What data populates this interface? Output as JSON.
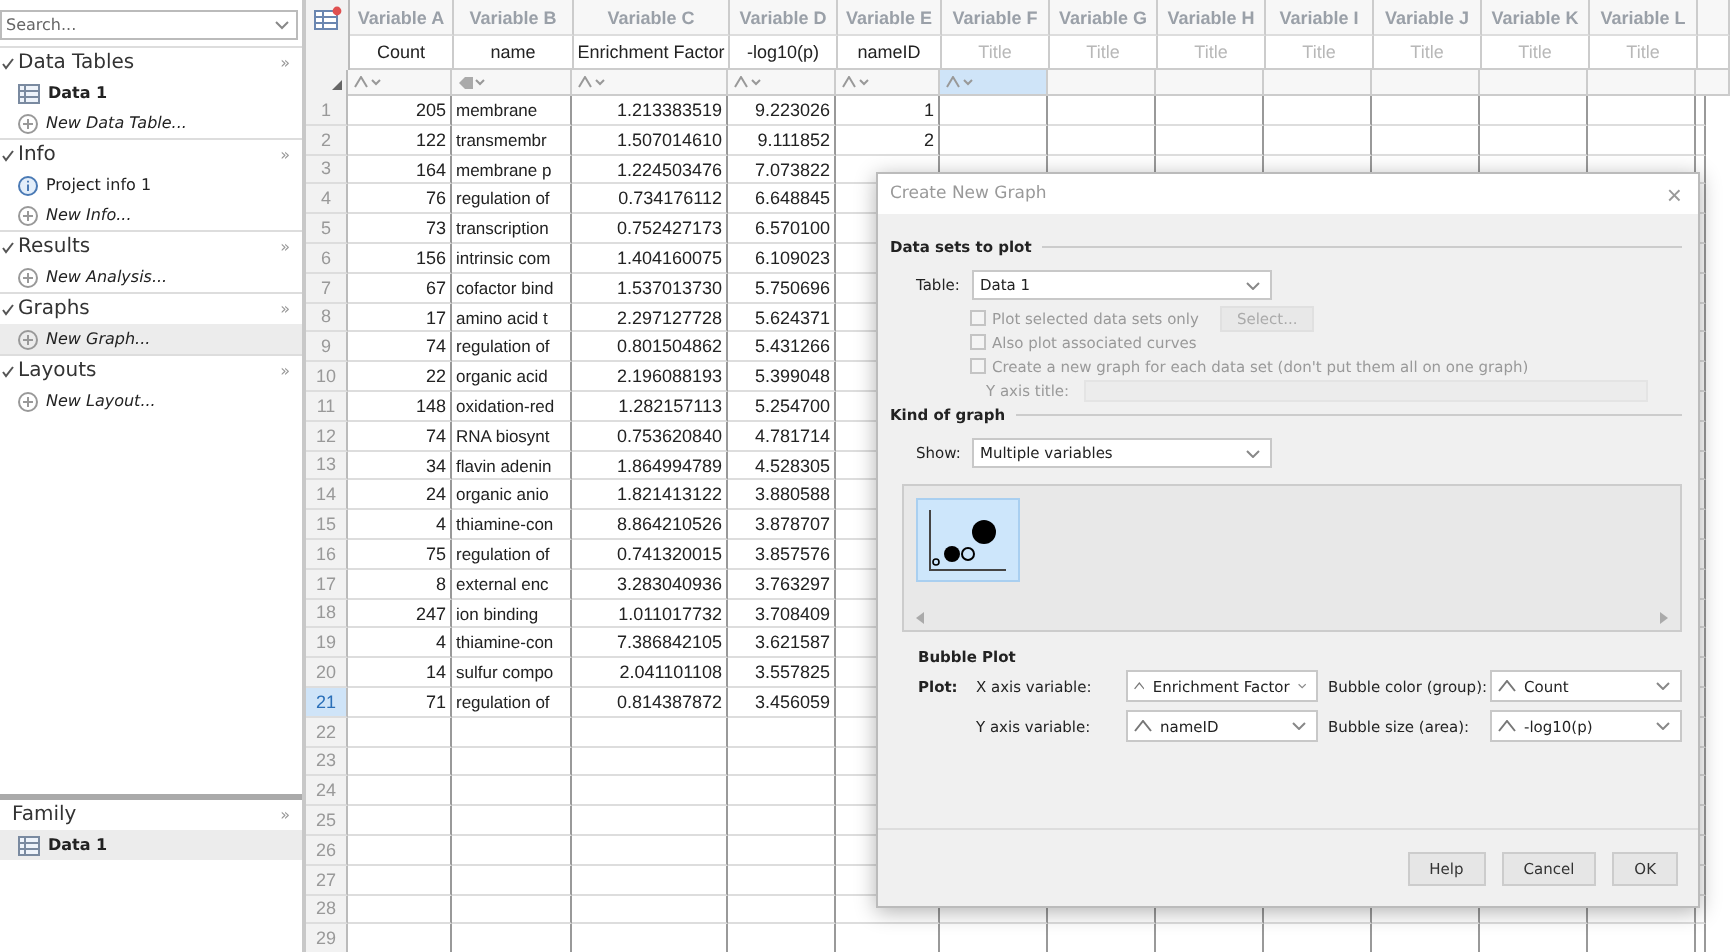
{
  "sidebar": {
    "search": {
      "placeholder": "Search..."
    },
    "sections": [
      {
        "title": "Data Tables",
        "more": "»",
        "expanded": true,
        "items": [
          {
            "kind": "table",
            "label": "Data 1",
            "selected": false
          },
          {
            "kind": "new",
            "label": "New Data Table...",
            "selected": false
          }
        ]
      },
      {
        "title": "Info",
        "more": "»",
        "expanded": true,
        "items": [
          {
            "kind": "info",
            "label": "Project info 1",
            "selected": false
          },
          {
            "kind": "new",
            "label": "New Info...",
            "selected": false
          }
        ]
      },
      {
        "title": "Results",
        "more": "»",
        "expanded": true,
        "items": [
          {
            "kind": "new",
            "label": "New Analysis...",
            "selected": false
          }
        ]
      },
      {
        "title": "Graphs",
        "more": "»",
        "expanded": true,
        "items": [
          {
            "kind": "new",
            "label": "New Graph...",
            "selected": true
          }
        ]
      },
      {
        "title": "Layouts",
        "more": "»",
        "expanded": true,
        "items": [
          {
            "kind": "new",
            "label": "New Layout...",
            "selected": false
          }
        ]
      }
    ],
    "family": {
      "title": "Family",
      "more": "»",
      "items": [
        {
          "kind": "table",
          "label": "Data 1",
          "selected": true
        }
      ]
    }
  },
  "table": {
    "columns": [
      {
        "header": "Variable A",
        "title": "Count",
        "title_placeholder": false,
        "kind": "number"
      },
      {
        "header": "Variable B",
        "title": "name",
        "title_placeholder": false,
        "kind": "text"
      },
      {
        "header": "Variable C",
        "title": "Enrichment Factor",
        "title_placeholder": false,
        "kind": "number"
      },
      {
        "header": "Variable D",
        "title": "-log10(p)",
        "title_placeholder": false,
        "kind": "number"
      },
      {
        "header": "Variable E",
        "title": "nameID",
        "title_placeholder": false,
        "kind": "number"
      },
      {
        "header": "Variable F",
        "title": "Title",
        "title_placeholder": true,
        "kind": "number"
      },
      {
        "header": "Variable G",
        "title": "Title",
        "title_placeholder": true,
        "kind": "empty"
      },
      {
        "header": "Variable H",
        "title": "Title",
        "title_placeholder": true,
        "kind": "empty"
      },
      {
        "header": "Variable I",
        "title": "Title",
        "title_placeholder": true,
        "kind": "empty"
      },
      {
        "header": "Variable J",
        "title": "Title",
        "title_placeholder": true,
        "kind": "empty"
      },
      {
        "header": "Variable K",
        "title": "Title",
        "title_placeholder": true,
        "kind": "empty"
      },
      {
        "header": "Variable L",
        "title": "Title",
        "title_placeholder": true,
        "kind": "empty"
      }
    ],
    "rows": [
      {
        "num": "1",
        "selected": false,
        "cells": [
          "205",
          "membrane",
          "1.213383519",
          "9.223026",
          "1"
        ]
      },
      {
        "num": "2",
        "selected": false,
        "cells": [
          "122",
          "transmembr",
          "1.507014610",
          "9.111852",
          "2"
        ]
      },
      {
        "num": "3",
        "selected": false,
        "cells": [
          "164",
          "membrane p",
          "1.224503476",
          "7.073822"
        ]
      },
      {
        "num": "4",
        "selected": false,
        "cells": [
          "76",
          "regulation of",
          "0.734176112",
          "6.648845"
        ]
      },
      {
        "num": "5",
        "selected": false,
        "cells": [
          "73",
          "transcription",
          "0.752427173",
          "6.570100"
        ]
      },
      {
        "num": "6",
        "selected": false,
        "cells": [
          "156",
          "intrinsic com",
          "1.404160075",
          "6.109023"
        ]
      },
      {
        "num": "7",
        "selected": false,
        "cells": [
          "67",
          "cofactor bind",
          "1.537013730",
          "5.750696"
        ]
      },
      {
        "num": "8",
        "selected": false,
        "cells": [
          "17",
          "amino acid t",
          "2.297127728",
          "5.624371"
        ]
      },
      {
        "num": "9",
        "selected": false,
        "cells": [
          "74",
          "regulation of",
          "0.801504862",
          "5.431266"
        ]
      },
      {
        "num": "10",
        "selected": false,
        "cells": [
          "22",
          "organic acid",
          "2.196088193",
          "5.399048"
        ]
      },
      {
        "num": "11",
        "selected": false,
        "cells": [
          "148",
          "oxidation-red",
          "1.282157113",
          "5.254700"
        ]
      },
      {
        "num": "12",
        "selected": false,
        "cells": [
          "74",
          "RNA biosynt",
          "0.753620840",
          "4.781714"
        ]
      },
      {
        "num": "13",
        "selected": false,
        "cells": [
          "34",
          "flavin adenin",
          "1.864994789",
          "4.528305"
        ]
      },
      {
        "num": "14",
        "selected": false,
        "cells": [
          "24",
          "organic anio",
          "1.821413122",
          "3.880588"
        ]
      },
      {
        "num": "15",
        "selected": false,
        "cells": [
          "4",
          "thiamine-con",
          "8.864210526",
          "3.878707"
        ]
      },
      {
        "num": "16",
        "selected": false,
        "cells": [
          "75",
          "regulation of",
          "0.741320015",
          "3.857576"
        ]
      },
      {
        "num": "17",
        "selected": false,
        "cells": [
          "8",
          "external enc",
          "3.283040936",
          "3.763297"
        ]
      },
      {
        "num": "18",
        "selected": false,
        "cells": [
          "247",
          "ion binding",
          "1.011017732",
          "3.708409"
        ]
      },
      {
        "num": "19",
        "selected": false,
        "cells": [
          "4",
          "thiamine-con",
          "7.386842105",
          "3.621587"
        ]
      },
      {
        "num": "20",
        "selected": false,
        "cells": [
          "14",
          "sulfur compo",
          "2.041101108",
          "3.557825"
        ]
      },
      {
        "num": "21",
        "selected": true,
        "cells": [
          "71",
          "regulation of",
          "0.814387872",
          "3.456059"
        ]
      },
      {
        "num": "22",
        "selected": false,
        "cells": []
      },
      {
        "num": "23",
        "selected": false,
        "cells": []
      },
      {
        "num": "24",
        "selected": false,
        "cells": []
      },
      {
        "num": "25",
        "selected": false,
        "cells": []
      },
      {
        "num": "26",
        "selected": false,
        "cells": []
      },
      {
        "num": "27",
        "selected": false,
        "cells": []
      },
      {
        "num": "28",
        "selected": false,
        "cells": []
      },
      {
        "num": "29",
        "selected": false,
        "cells": []
      }
    ]
  },
  "dialog": {
    "title": "Create New Graph",
    "close": "×",
    "data_sets": {
      "heading": "Data sets to plot",
      "table_label": "Table:",
      "table_value": "Data 1",
      "options": [
        {
          "label": "Plot selected data sets only",
          "checked": false,
          "disabled": true
        },
        {
          "label": "Also plot associated curves",
          "checked": false,
          "disabled": true
        },
        {
          "label": "Create a new graph for each data set (don't put them all on one graph)",
          "checked": false,
          "disabled": true
        }
      ],
      "select_button": "Select...",
      "y_axis_label": "Y axis title:"
    },
    "kind": {
      "heading": "Kind of graph",
      "show_label": "Show:",
      "show_value": "Multiple variables",
      "gallery": [
        {
          "kind": "bubble",
          "selected": true
        }
      ]
    },
    "plot": {
      "heading": "Bubble Plot",
      "label": "Plot:",
      "fields": [
        {
          "label": "X axis variable:",
          "value": "Enrichment Factor"
        },
        {
          "label": "Bubble color (group):",
          "value": "Count"
        },
        {
          "label": "Y axis variable:",
          "value": "nameID"
        },
        {
          "label": "Bubble size (area):",
          "value": "-log10(p)"
        }
      ]
    },
    "buttons": [
      "Help",
      "Cancel",
      "OK"
    ]
  }
}
